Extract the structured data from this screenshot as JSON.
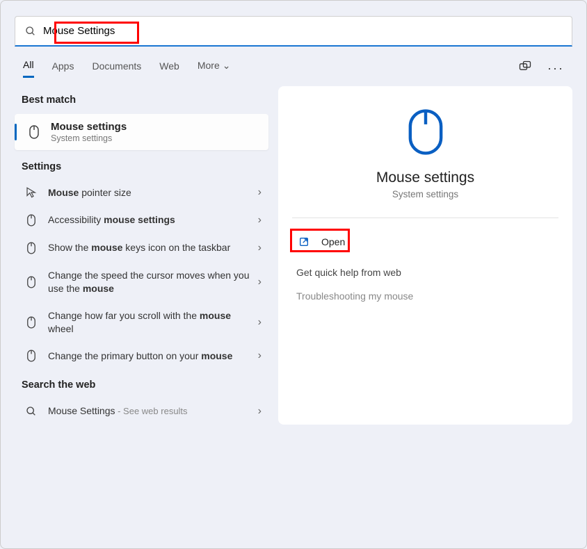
{
  "search": {
    "value": "Mouse Settings"
  },
  "tabs": {
    "all": "All",
    "apps": "Apps",
    "documents": "Documents",
    "web": "Web",
    "more": "More"
  },
  "sections": {
    "best_match": "Best match",
    "settings": "Settings",
    "search_web": "Search the web"
  },
  "best_match": {
    "title": "Mouse settings",
    "subtitle": "System settings"
  },
  "settings_results": [
    {
      "pre": "",
      "bold": "Mouse",
      "post": " pointer size"
    },
    {
      "pre": "Accessibility ",
      "bold": "mouse settings",
      "post": ""
    },
    {
      "pre": "Show the ",
      "bold": "mouse",
      "post": " keys icon on the taskbar"
    },
    {
      "pre": "Change the speed the cursor moves when you use the ",
      "bold": "mouse",
      "post": ""
    },
    {
      "pre": "Change how far you scroll with the ",
      "bold": "mouse",
      "post": " wheel"
    },
    {
      "pre": "Change the primary button on your ",
      "bold": "mouse",
      "post": ""
    }
  ],
  "web_result": {
    "term": "Mouse Settings",
    "suffix": " - See web results"
  },
  "preview": {
    "title": "Mouse settings",
    "subtitle": "System settings",
    "open_label": "Open",
    "help_header": "Get quick help from web",
    "help_links": [
      "Troubleshooting my mouse"
    ]
  },
  "colors": {
    "accent": "#0067c0",
    "highlight": "#ff0000"
  }
}
